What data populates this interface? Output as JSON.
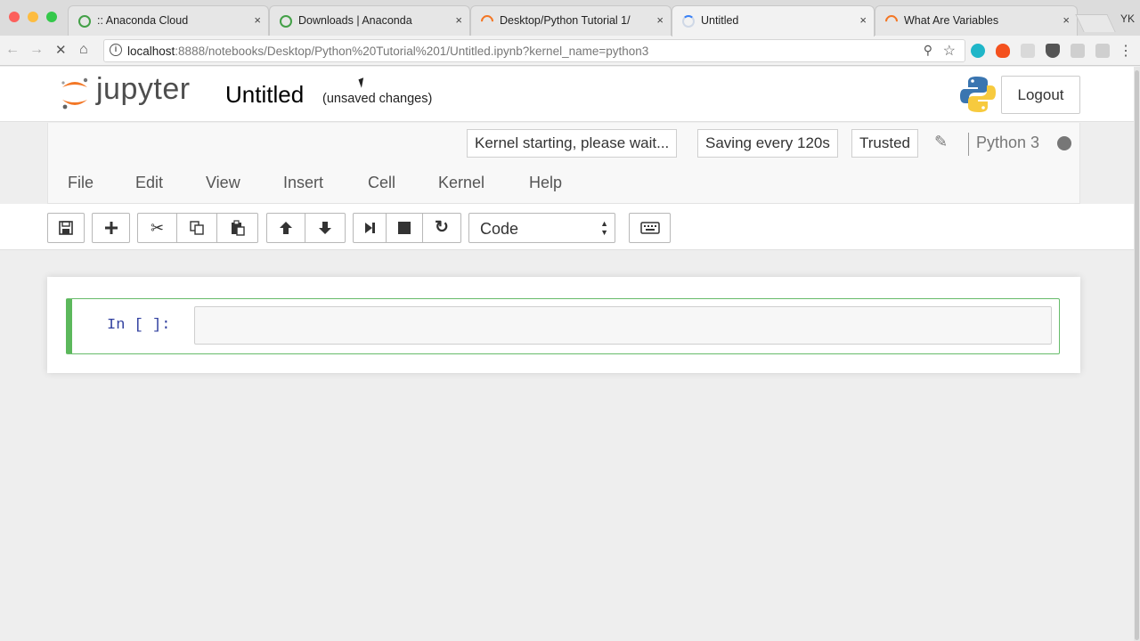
{
  "browser": {
    "tabs": [
      {
        "title": ":: Anaconda Cloud",
        "favicon": "anaconda-icon"
      },
      {
        "title": "Downloads | Anaconda",
        "favicon": "anaconda-icon"
      },
      {
        "title": "Desktop/Python Tutorial 1/",
        "favicon": "jupyter-icon"
      },
      {
        "title": "Untitled",
        "favicon": "loading-spinner-icon"
      },
      {
        "title": "What Are Variables",
        "favicon": "jupyter-icon"
      }
    ],
    "close_glyph": "×",
    "profile": "YK",
    "url_host": "localhost",
    "url_rest": ":8888/notebooks/Desktop/Python%20Tutorial%201/Untitled.ipynb?kernel_name=python3"
  },
  "jupyter": {
    "logo_text": "jupyter",
    "notebook_title": "Untitled",
    "save_status": "(unsaved changes)",
    "logout_label": "Logout"
  },
  "indicators": {
    "kernel_status": "Kernel starting, please wait...",
    "autosave": "Saving every 120s",
    "trusted": "Trusted",
    "kernel_name": "Python 3"
  },
  "menu": [
    "File",
    "Edit",
    "View",
    "Insert",
    "Cell",
    "Kernel",
    "Help"
  ],
  "toolbar": {
    "cell_type": "Code"
  },
  "cell": {
    "prompt": "In [ ]:",
    "source": ""
  },
  "colors": {
    "jupyter_orange": "#f37726",
    "cell_edit_green": "#5cb85c",
    "prompt_blue": "#303f9f"
  }
}
